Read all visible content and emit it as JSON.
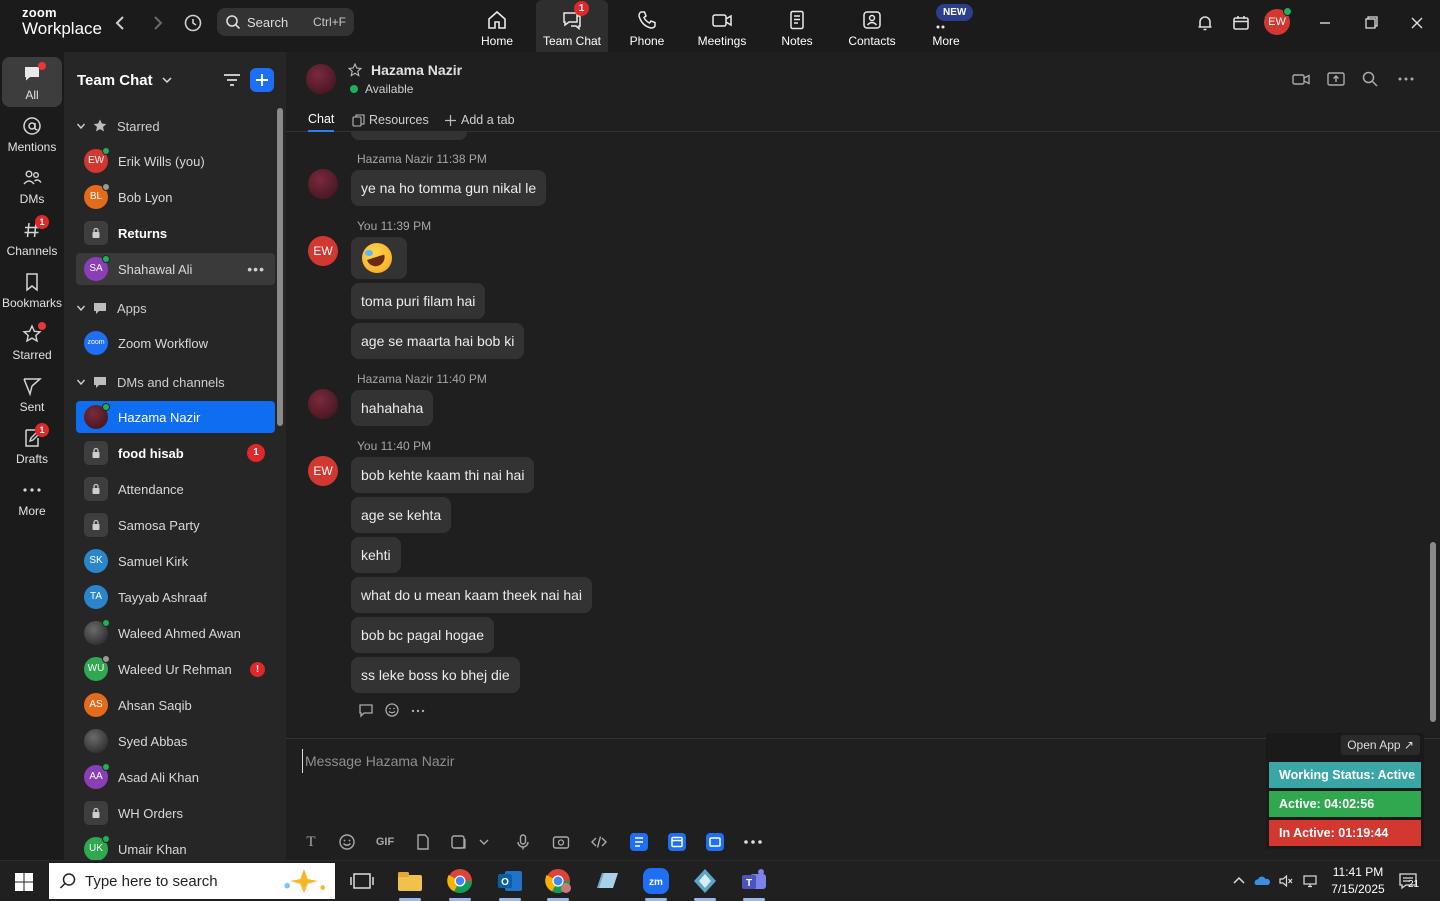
{
  "app": {
    "logo_line1": "zoom",
    "logo_line2": "Workplace",
    "search_placeholder": "Search",
    "search_shortcut": "Ctrl+F",
    "avatar_initials": "EW"
  },
  "topnav": [
    {
      "label": "Home",
      "icon": "home-icon"
    },
    {
      "label": "Team Chat",
      "icon": "chat-icon",
      "badge": "1",
      "active": true
    },
    {
      "label": "Phone",
      "icon": "phone-icon"
    },
    {
      "label": "Meetings",
      "icon": "video-icon"
    },
    {
      "label": "Notes",
      "icon": "notes-icon"
    },
    {
      "label": "Contacts",
      "icon": "contacts-icon"
    },
    {
      "label": "More",
      "icon": "more-icon",
      "new_badge": "NEW"
    }
  ],
  "rail": [
    {
      "label": "All",
      "icon": "chat-bubble-icon",
      "active": true,
      "dot": true
    },
    {
      "label": "Mentions",
      "icon": "at-icon"
    },
    {
      "label": "DMs",
      "icon": "people-icon"
    },
    {
      "label": "Channels",
      "icon": "hash-icon",
      "badge": "1"
    },
    {
      "label": "Bookmarks",
      "icon": "bookmark-icon"
    },
    {
      "label": "Starred",
      "icon": "star-icon",
      "dot": true
    },
    {
      "label": "Sent",
      "icon": "send-icon"
    },
    {
      "label": "Drafts",
      "icon": "draft-icon",
      "badge": "1"
    },
    {
      "label": "More",
      "icon": "ellipsis-icon"
    }
  ],
  "sidebar": {
    "title": "Team Chat",
    "sections": {
      "starred": "Starred",
      "apps": "Apps",
      "dms": "DMs and channels"
    },
    "starred_items": [
      {
        "name": "Erik Wills (you)",
        "initials": "EW",
        "color": "#d2382f",
        "status": "#20b05a"
      },
      {
        "name": "Bob Lyon",
        "initials": "BL",
        "color": "#e46b1c",
        "status": "#9a9a9a"
      },
      {
        "name": "Returns",
        "lock": true,
        "bold": true
      },
      {
        "name": "Shahawal Ali",
        "initials": "SA",
        "color": "#8a3fb8",
        "status": "#20b05a",
        "hover": true
      }
    ],
    "app_items": [
      {
        "name": "Zoom Workflow",
        "initials": "zoom",
        "color": "#1e6ff5"
      }
    ],
    "dm_items": [
      {
        "name": "Hazama Nazir",
        "photo": true,
        "status": "#20b05a",
        "selected": true
      },
      {
        "name": "food hisab",
        "lock": true,
        "bold": true,
        "badge": "1"
      },
      {
        "name": "Attendance",
        "lock": true
      },
      {
        "name": "Samosa Party",
        "lock": true
      },
      {
        "name": "Samuel Kirk",
        "initials": "SK",
        "color": "#2a86c9"
      },
      {
        "name": "Tayyab Ashraaf",
        "initials": "TA",
        "color": "#2a86c9"
      },
      {
        "name": "Waleed Ahmed Awan",
        "photo": true,
        "status": "#20b05a"
      },
      {
        "name": "Waleed Ur Rehman",
        "initials": "WU",
        "color": "#2fa84f",
        "status": "#9a9a9a",
        "alert": "!"
      },
      {
        "name": "Ahsan Saqib",
        "initials": "AS",
        "color": "#e46b1c"
      },
      {
        "name": "Syed Abbas",
        "photo": true
      },
      {
        "name": "Asad Ali Khan",
        "initials": "AA",
        "color": "#8a3fb8",
        "status": "#20b05a"
      },
      {
        "name": "WH Orders",
        "lock": true
      },
      {
        "name": "Umair Khan",
        "initials": "UK",
        "color": "#2fa84f",
        "status": "#20b05a"
      }
    ]
  },
  "chat": {
    "name": "Hazama Nazir",
    "status": "Available",
    "tabs": [
      "Chat",
      "Resources",
      "Add a tab"
    ],
    "messages": [
      {
        "sender": "Hazama Nazir",
        "time": "11:38 PM",
        "who": "hz",
        "texts": [
          "ye na ho tomma gun nikal le"
        ]
      },
      {
        "sender": "You",
        "time": "11:39 PM",
        "who": "ew",
        "emoji": true,
        "texts": [
          "toma puri filam hai",
          "age se maarta hai bob ki"
        ]
      },
      {
        "sender": "Hazama Nazir",
        "time": "11:40 PM",
        "who": "hz",
        "texts": [
          "hahahaha"
        ]
      },
      {
        "sender": "You",
        "time": "11:40 PM",
        "who": "ew",
        "texts": [
          "bob kehte kaam thi nai hai",
          "age se kehta",
          "kehti",
          "what do u mean kaam theek nai hai",
          "bob bc pagal hogae",
          "ss leke boss ko bhej die"
        ]
      }
    ],
    "composer_placeholder": "Message Hazama Nazir"
  },
  "widget": {
    "open_app": "Open App ↗",
    "working_status": "Working Status: Active",
    "active": "Active: 04:02:56",
    "inactive": "In Active: 01:19:44",
    "colors": {
      "status": "#3aa6a6",
      "active": "#2fa84f",
      "inactive": "#d2382f"
    }
  },
  "taskbar": {
    "search_placeholder": "Type here to search",
    "time": "11:41 PM",
    "date": "7/15/2025",
    "notifications": "21"
  }
}
